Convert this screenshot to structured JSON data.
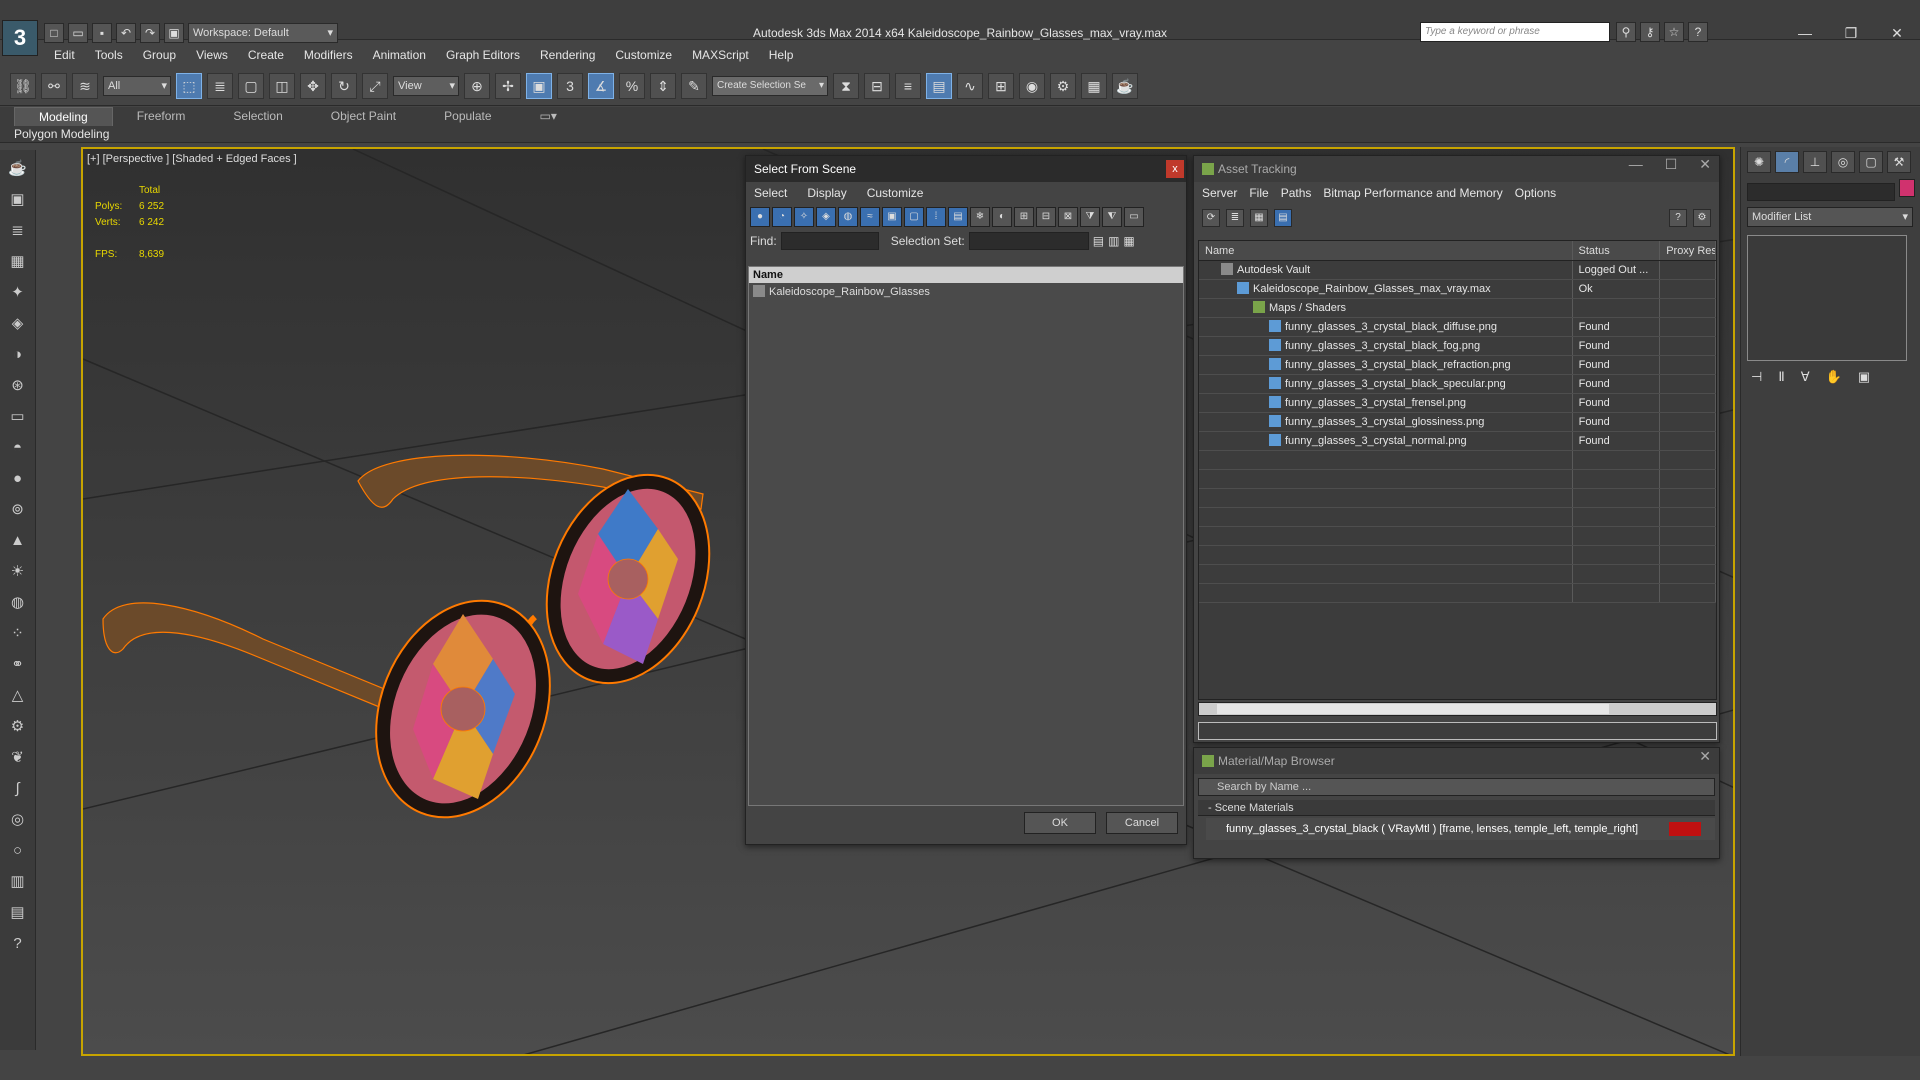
{
  "app": {
    "title": "Autodesk 3ds Max  2014 x64     Kaleidoscope_Rainbow_Glasses_max_vray.max",
    "workspace": "Workspace: Default",
    "search_placeholder": "Type a keyword or phrase"
  },
  "menu": [
    "Edit",
    "Tools",
    "Group",
    "Views",
    "Create",
    "Modifiers",
    "Animation",
    "Graph Editors",
    "Rendering",
    "Customize",
    "MAXScript",
    "Help"
  ],
  "toolbar": {
    "filter": "All",
    "ref_coord": "View",
    "selection_set_placeholder": "Create Selection Se",
    "snap_label": "3"
  },
  "ribbon": {
    "tabs": [
      "Modeling",
      "Freeform",
      "Selection",
      "Object Paint",
      "Populate"
    ],
    "sub": "Polygon Modeling"
  },
  "viewport": {
    "label": "[+] [Perspective ] [Shaded + Edged Faces ]",
    "stats_header": "Total",
    "polys_label": "Polys:",
    "polys": "6 252",
    "verts_label": "Verts:",
    "verts": "6 242",
    "fps_label": "FPS:",
    "fps": "8,639"
  },
  "select_from_scene": {
    "title": "Select From Scene",
    "close": "x",
    "menu": [
      "Select",
      "Display",
      "Customize"
    ],
    "find_label": "Find:",
    "selset_label": "Selection Set:",
    "column": "Name",
    "items": [
      "Kaleidoscope_Rainbow_Glasses"
    ],
    "ok": "OK",
    "cancel": "Cancel"
  },
  "asset_tracking": {
    "title": "Asset Tracking",
    "menu": [
      "Server",
      "File",
      "Paths",
      "Bitmap Performance and Memory",
      "Options"
    ],
    "columns": [
      "Name",
      "Status",
      "Proxy Res"
    ],
    "rows": [
      {
        "name": "Autodesk Vault",
        "status": "Logged Out ...",
        "indent": 1,
        "icon": "v"
      },
      {
        "name": "Kaleidoscope_Rainbow_Glasses_max_vray.max",
        "status": "Ok",
        "indent": 2,
        "icon": "b"
      },
      {
        "name": "Maps / Shaders",
        "status": "",
        "indent": 3,
        "icon": "g"
      },
      {
        "name": "funny_glasses_3_crystal_black_diffuse.png",
        "status": "Found",
        "indent": 4,
        "icon": "b"
      },
      {
        "name": "funny_glasses_3_crystal_black_fog.png",
        "status": "Found",
        "indent": 4,
        "icon": "b"
      },
      {
        "name": "funny_glasses_3_crystal_black_refraction.png",
        "status": "Found",
        "indent": 4,
        "icon": "b"
      },
      {
        "name": "funny_glasses_3_crystal_black_specular.png",
        "status": "Found",
        "indent": 4,
        "icon": "b"
      },
      {
        "name": "funny_glasses_3_crystal_frensel.png",
        "status": "Found",
        "indent": 4,
        "icon": "b"
      },
      {
        "name": "funny_glasses_3_crystal_glossiness.png",
        "status": "Found",
        "indent": 4,
        "icon": "b"
      },
      {
        "name": "funny_glasses_3_crystal_normal.png",
        "status": "Found",
        "indent": 4,
        "icon": "b"
      }
    ]
  },
  "material_browser": {
    "title": "Material/Map Browser",
    "search_placeholder": "Search by Name ...",
    "group": "- Scene Materials",
    "material": "funny_glasses_3_crystal_black  ( VRayMtl )  [frame, lenses, temple_left, temple_right]",
    "swatch_color": "#c01010"
  },
  "command_panel": {
    "modifier_list": "Modifier List",
    "object_color": "#d0326e"
  }
}
